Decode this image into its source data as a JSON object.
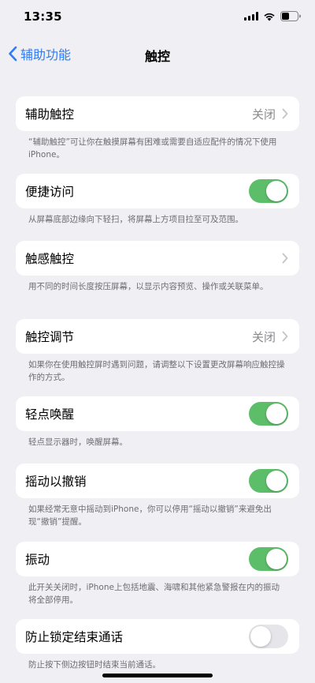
{
  "status_bar": {
    "time": "13:35"
  },
  "nav": {
    "back_label": "辅助功能",
    "title": "触控"
  },
  "rows": {
    "assistive_touch": {
      "label": "辅助触控",
      "value": "关闭",
      "footer": "“辅助触控”可让你在触摸屏幕有困难或需要自适应配件的情况下使用iPhone。"
    },
    "reachability": {
      "label": "便捷访问",
      "toggle_on": true,
      "footer": "从屏幕底部边缘向下轻扫，将屏幕上方项目拉至可及范围。"
    },
    "haptic_touch": {
      "label": "触感触控",
      "footer": "用不同的时间长度按压屏幕，以显示内容预览、操作或关联菜单。"
    },
    "touch_accommodations": {
      "label": "触控调节",
      "value": "关闭",
      "footer": "如果你在使用触控屏时遇到问题，请调整以下设置更改屏幕响应触控操作的方式。"
    },
    "tap_to_wake": {
      "label": "轻点唤醒",
      "toggle_on": true,
      "footer": "轻点显示器时，唤醒屏幕。"
    },
    "shake_to_undo": {
      "label": "摇动以撤销",
      "toggle_on": true,
      "footer": "如果经常无意中摇动到iPhone，你可以停用“摇动以撤销”来避免出现“撤销”提醒。"
    },
    "vibration": {
      "label": "振动",
      "toggle_on": true,
      "footer": "此开关关闭时，iPhone上包括地震、海啸和其他紧急警报在内的振动将全部停用。"
    },
    "prevent_lock_end_call": {
      "label": "防止锁定结束通话",
      "toggle_on": false,
      "footer": "防止按下侧边按钮时结束当前通话。"
    }
  },
  "colors": {
    "accent": "#2f7cf6",
    "toggle_on": "#5dbe6a",
    "toggle_off": "#e6e6ea",
    "background": "#efeff4"
  },
  "icons": [
    "signal-icon",
    "wifi-icon",
    "battery-icon",
    "chevron-left-icon",
    "chevron-right-icon"
  ]
}
